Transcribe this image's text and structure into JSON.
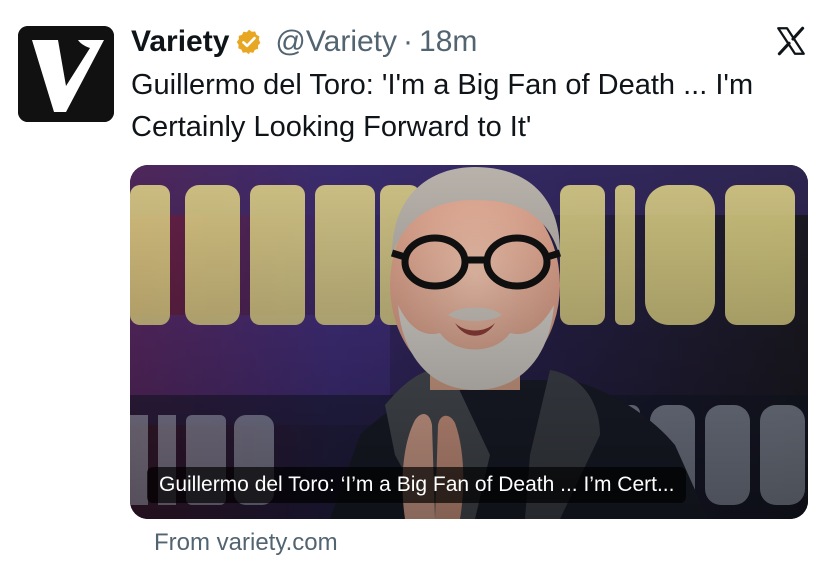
{
  "author": {
    "display_name": "Variety",
    "handle": "@Variety",
    "separator": "·",
    "time_ago": "18m",
    "avatar_icon": "variety-v-logo-icon",
    "verified_icon": "verified-badge-icon",
    "verified_color": "#E8A723"
  },
  "platform_icon": "x-logo-icon",
  "tweet": {
    "text": "Guillermo del Toro: 'I'm a Big Fan of Death ... I'm Certainly Looking Forward to It'"
  },
  "card": {
    "caption": "Guillermo del Toro: ‘I’m a Big Fan of Death ... I’m Cert...",
    "source": "From variety.com"
  }
}
